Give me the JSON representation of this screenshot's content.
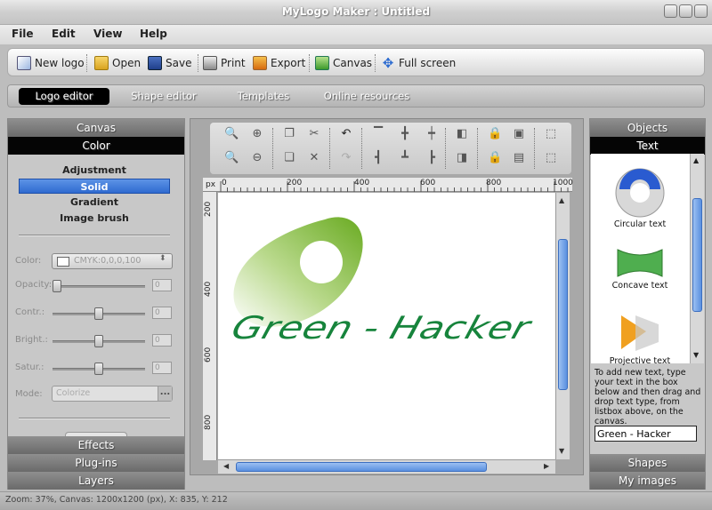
{
  "window": {
    "title": "MyLogo Maker : Untitled"
  },
  "menu": [
    "File",
    "Edit",
    "View",
    "Help"
  ],
  "toolbar": {
    "new_logo": "New logo",
    "open": "Open",
    "save": "Save",
    "print": "Print",
    "export": "Export",
    "canvas": "Canvas",
    "full_screen": "Full screen"
  },
  "tabs": [
    "Logo editor",
    "Shape editor",
    "Templates",
    "Online resources"
  ],
  "left_panel": {
    "canvas_header": "Canvas",
    "color_header": "Color",
    "options": [
      "Adjustment",
      "Solid",
      "Gradient",
      "Image brush"
    ],
    "selected_option": "Solid",
    "color_label": "Color:",
    "color_value": "CMYK:0,0,0,100",
    "opacity_label": "Opacity:",
    "opacity_value": "0",
    "contrast_label": "Contr.:",
    "contrast_value": "0",
    "bright_label": "Bright.:",
    "bright_value": "0",
    "satur_label": "Satur.:",
    "satur_value": "0",
    "mode_label": "Mode:",
    "mode_value": "Colorize",
    "mode_button": "...",
    "effects": "Effects",
    "plugins": "Plug-ins",
    "layers": "Layers"
  },
  "rulers": {
    "unit": "px",
    "top_ticks": [
      "0",
      "200",
      "400",
      "600",
      "800",
      "1000"
    ],
    "left_ticks": [
      "200",
      "400",
      "600",
      "800"
    ]
  },
  "logo": {
    "text": "Green - Hacker",
    "colors": {
      "green_dark": "#16803a",
      "green_light": "#7ab82e"
    }
  },
  "right_panel": {
    "objects_header": "Objects",
    "text_header": "Text",
    "items": [
      "Circular text",
      "Concave text",
      "Projective text"
    ],
    "help": "To add new text, type your text in the box below and then drag and drop text type, from listbox above, on the canvas.",
    "text_value": "Green - Hacker",
    "shapes": "Shapes",
    "my_images": "My images"
  },
  "status": {
    "text": "Zoom: 37%, Canvas: 1200x1200 (px), X: 835, Y: 212"
  }
}
